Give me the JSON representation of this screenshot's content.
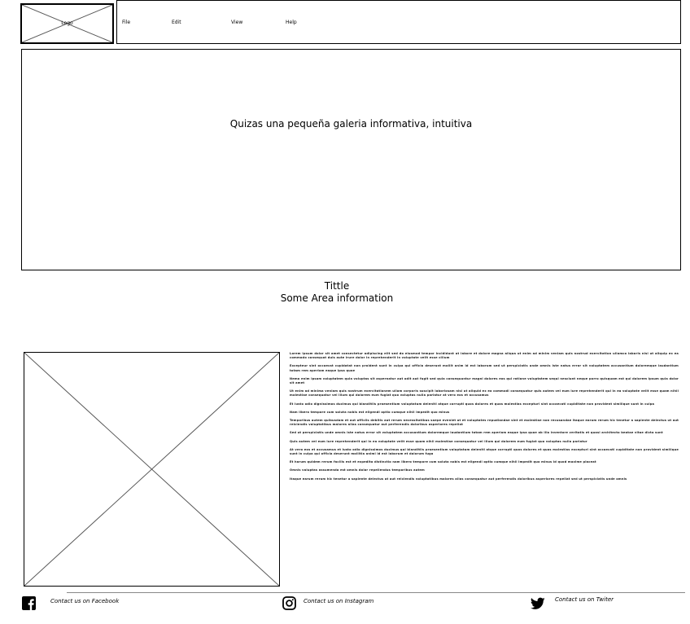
{
  "header": {
    "logo_label": "Logo",
    "menu": [
      {
        "label": "File"
      },
      {
        "label": "Edit"
      },
      {
        "label": "View"
      },
      {
        "label": "Help"
      }
    ]
  },
  "hero": {
    "text": "Quizas una pequeña galeria informativa, intuitiva"
  },
  "section": {
    "title": "Tittle",
    "subtitle": "Some Area information"
  },
  "content": {
    "paragraphs": [
      "Lorem ipsum dolor sit amet consectetur adipiscing elit sed do eiusmod tempor incididunt ut labore et dolore magna aliqua ut enim ad minim veniam quis nostrud exercitation ullamco laboris nisi ut aliquip ex ea commodo consequat duis aute irure dolor in reprehenderit in voluptate velit esse cillum",
      "Excepteur sint occaecat cupidatat non proident sunt in culpa qui officia deserunt mollit anim id est laborum sed ut perspiciatis unde omnis iste natus error sit voluptatem accusantium doloremque laudantium totam rem aperiam eaque ipsa quae",
      "Nemo enim ipsam voluptatem quia voluptas sit aspernatur aut odit aut fugit sed quia consequuntur magni dolores eos qui ratione voluptatem sequi nesciunt neque porro quisquam est qui dolorem ipsum quia dolor sit amet",
      "Ut enim ad minima veniam quis nostrum exercitationem ullam corporis suscipit laboriosam nisi ut aliquid ex ea commodi consequatur quis autem vel eum iure reprehenderit qui in ea voluptate velit esse quam nihil molestiae consequatur vel illum qui dolorem eum fugiat quo voluptas nulla pariatur at vero eos et accusamus",
      "Et iusto odio dignissimos ducimus qui blanditiis praesentium voluptatum deleniti atque corrupti quos dolores et quas molestias excepturi sint occaecati cupiditate non provident similique sunt in culpa",
      "Nam libero tempore cum soluta nobis est eligendi optio cumque nihil impedit quo minus",
      "Temporibus autem quibusdam et aut officiis debitis aut rerum necessitatibus saepe eveniet ut et voluptates repudiandae sint et molestiae non recusandae itaque earum rerum hic tenetur a sapiente delectus ut aut reiciendis voluptatibus maiores alias consequatur aut perferendis doloribus asperiores repellat",
      "Sed ut perspiciatis unde omnis iste natus error sit voluptatem accusantium doloremque laudantium totam rem aperiam eaque ipsa quae ab illo inventore veritatis et quasi architecto beatae vitae dicta sunt",
      "Quis autem vel eum iure reprehenderit qui in ea voluptate velit esse quam nihil molestiae consequatur vel illum qui dolorem eum fugiat quo voluptas nulla pariatur",
      "At vero eos et accusamus et iusto odio dignissimos ducimus qui blanditiis praesentium voluptatum deleniti atque corrupti quos dolores et quas molestias excepturi sint occaecati cupiditate non provident similique sunt in culpa qui officia deserunt mollitia animi id est laborum et dolorum fuga",
      "Et harum quidem rerum facilis est et expedita distinctio nam libero tempore cum soluta nobis est eligendi optio cumque nihil impedit quo minus id quod maxime placeat",
      "Omnis voluptas assumenda est omnis dolor repellendus temporibus autem",
      "Itaque earum rerum hic tenetur a sapiente delectus ut aut reiciendis voluptatibus maiores alias consequatur aut perferendis doloribus asperiores repellat sed ut perspiciatis unde omnis"
    ]
  },
  "footer": {
    "facebook": "Contact us on Facebook",
    "instagram": "Contact us on Instagram",
    "twitter": "Contact us on Twiter"
  }
}
